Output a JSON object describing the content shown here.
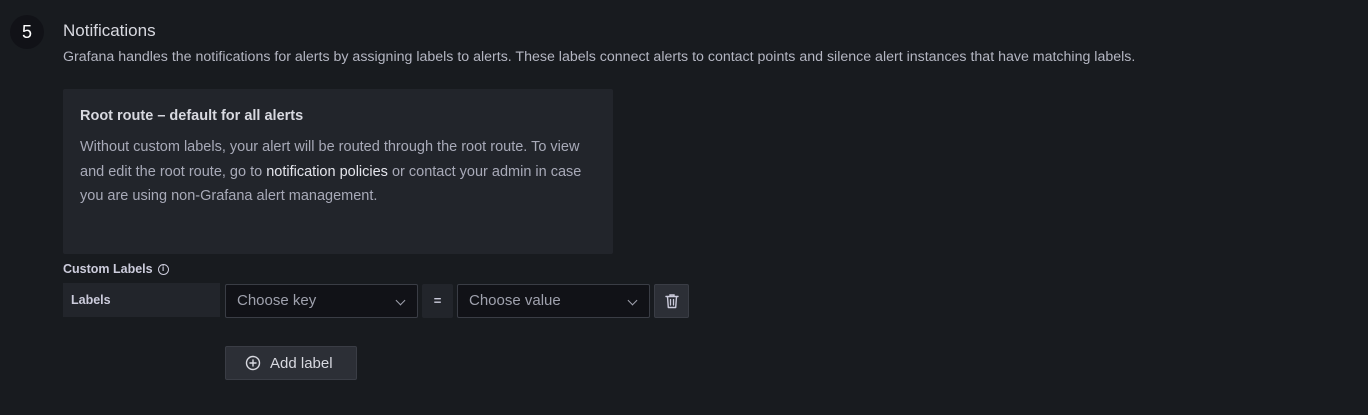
{
  "step": {
    "number": "5",
    "title": "Notifications",
    "description": "Grafana handles the notifications for alerts by assigning labels to alerts. These labels connect alerts to contact points and silence alert instances that have matching labels."
  },
  "info_box": {
    "title": "Root route – default for all alerts",
    "body_before_link": "Without custom labels, your alert will be routed through the root route. To view and edit the root route, go to ",
    "link_text": "notification policies",
    "body_after_link": " or contact your admin in case you are using non-Grafana alert management."
  },
  "custom_labels": {
    "title": "Custom Labels",
    "info_icon": "info-circle-icon",
    "row": {
      "tag": "Labels",
      "key_placeholder": "Choose key",
      "operator": "=",
      "value_placeholder": "Choose value",
      "delete_icon": "trash-icon"
    },
    "add_button_label": "Add label",
    "add_icon": "plus-circle-icon"
  }
}
